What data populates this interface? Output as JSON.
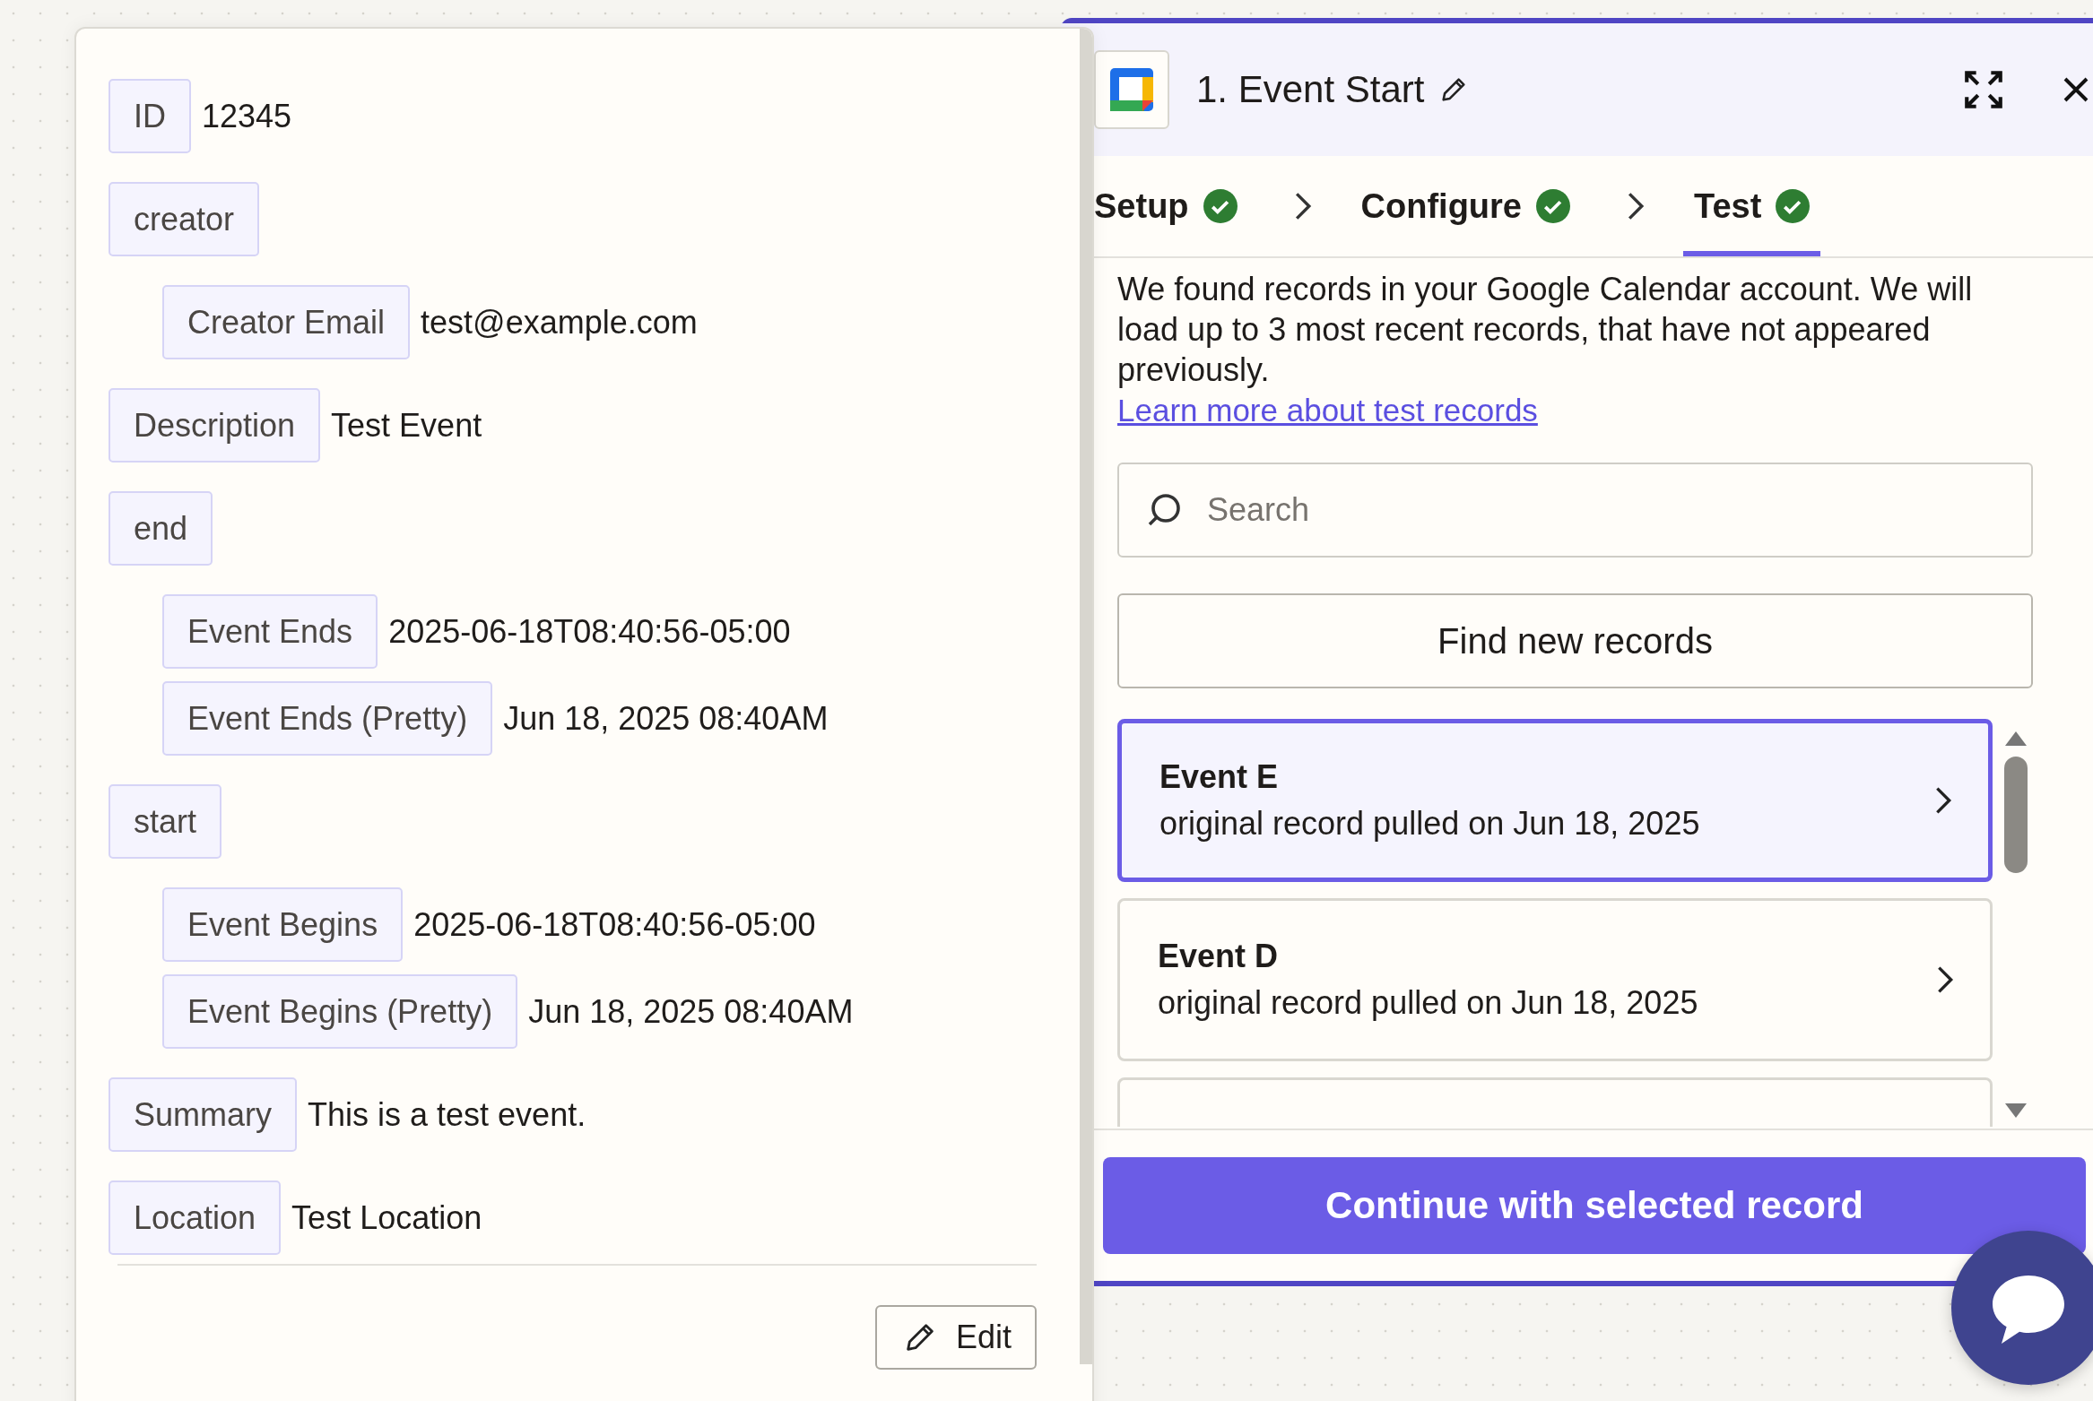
{
  "record_panel": {
    "fields": [
      {
        "label": "ID",
        "value": "12345"
      },
      {
        "label": "creator",
        "children": [
          {
            "label": "Creator Email",
            "value": "test@example.com"
          }
        ]
      },
      {
        "label": "Description",
        "value": "Test Event"
      },
      {
        "label": "end",
        "children": [
          {
            "label": "Event Ends",
            "value": "2025-06-18T08:40:56-05:00"
          },
          {
            "label": "Event Ends (Pretty)",
            "value": "Jun 18, 2025 08:40AM"
          }
        ]
      },
      {
        "label": "start",
        "children": [
          {
            "label": "Event Begins",
            "value": "2025-06-18T08:40:56-05:00"
          },
          {
            "label": "Event Begins (Pretty)",
            "value": "Jun 18, 2025 08:40AM"
          }
        ]
      },
      {
        "label": "Summary",
        "value": "This is a test event."
      },
      {
        "label": "Location",
        "value": "Test Location"
      }
    ],
    "edit_button": "Edit"
  },
  "step_panel": {
    "title": "1. Event Start",
    "steps": [
      {
        "label": "Setup",
        "done": true,
        "selected": false
      },
      {
        "label": "Configure",
        "done": true,
        "selected": false
      },
      {
        "label": "Test",
        "done": true,
        "selected": true
      }
    ],
    "intro": "We found records in your Google Calendar account. We will load up to 3 most recent records, that have not appeared previously.",
    "learn_more_link": "Learn more about test records",
    "search": {
      "placeholder": "Search"
    },
    "find_button": "Find new records",
    "records": [
      {
        "title": "Event E",
        "subtitle": "original record pulled on Jun 18, 2025",
        "selected": true
      },
      {
        "title": "Event D",
        "subtitle": "original record pulled on Jun 18, 2025",
        "selected": false
      }
    ],
    "continue_button": "Continue with selected record"
  }
}
